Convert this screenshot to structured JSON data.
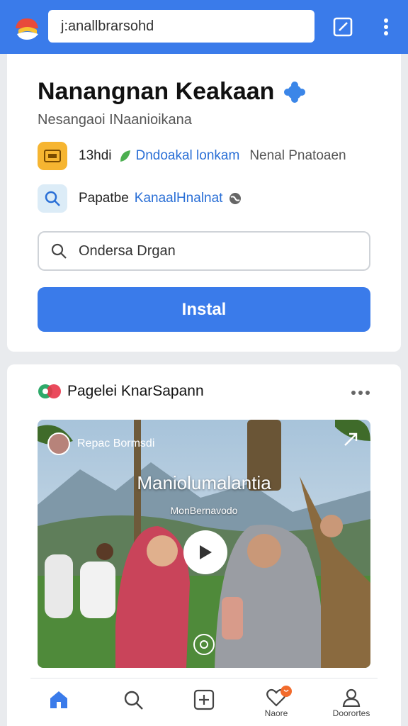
{
  "topbar": {
    "url_text": "j:anallbrarsohd",
    "colors": {
      "bar": "#3a7bea"
    }
  },
  "app": {
    "title": "Nanangnan Keakaan",
    "subtitle": "Nesangaoi  INaanioikana",
    "meta_row1": {
      "a": "13hdi",
      "b": "Dndoakal lonkam",
      "c": "Nenal Pnatoaen"
    },
    "meta_row2": {
      "a": "Papatbe",
      "b": "KanaalHnalnat"
    },
    "search_value": "Ondersa Drgan",
    "install_label": "Instal"
  },
  "post": {
    "page_name": "Pagelei KnarSapann",
    "video": {
      "channel": "Repac Bormsdi",
      "title": "Maniolumalantia",
      "subtitle": "MonBernavodo"
    }
  },
  "nav": {
    "notifications_label": "Naore",
    "profile_label": "Doorortes",
    "active": "home"
  },
  "icons": [
    "logo-icon",
    "edit-icon",
    "more-vertical-icon",
    "verified-badge-icon",
    "app-chip-icon",
    "leaf-icon",
    "search-icon",
    "globe-icon",
    "page-icon",
    "more-horizontal-icon",
    "share-icon",
    "play-icon",
    "home-icon",
    "add-icon",
    "heart-icon",
    "profile-icon"
  ]
}
